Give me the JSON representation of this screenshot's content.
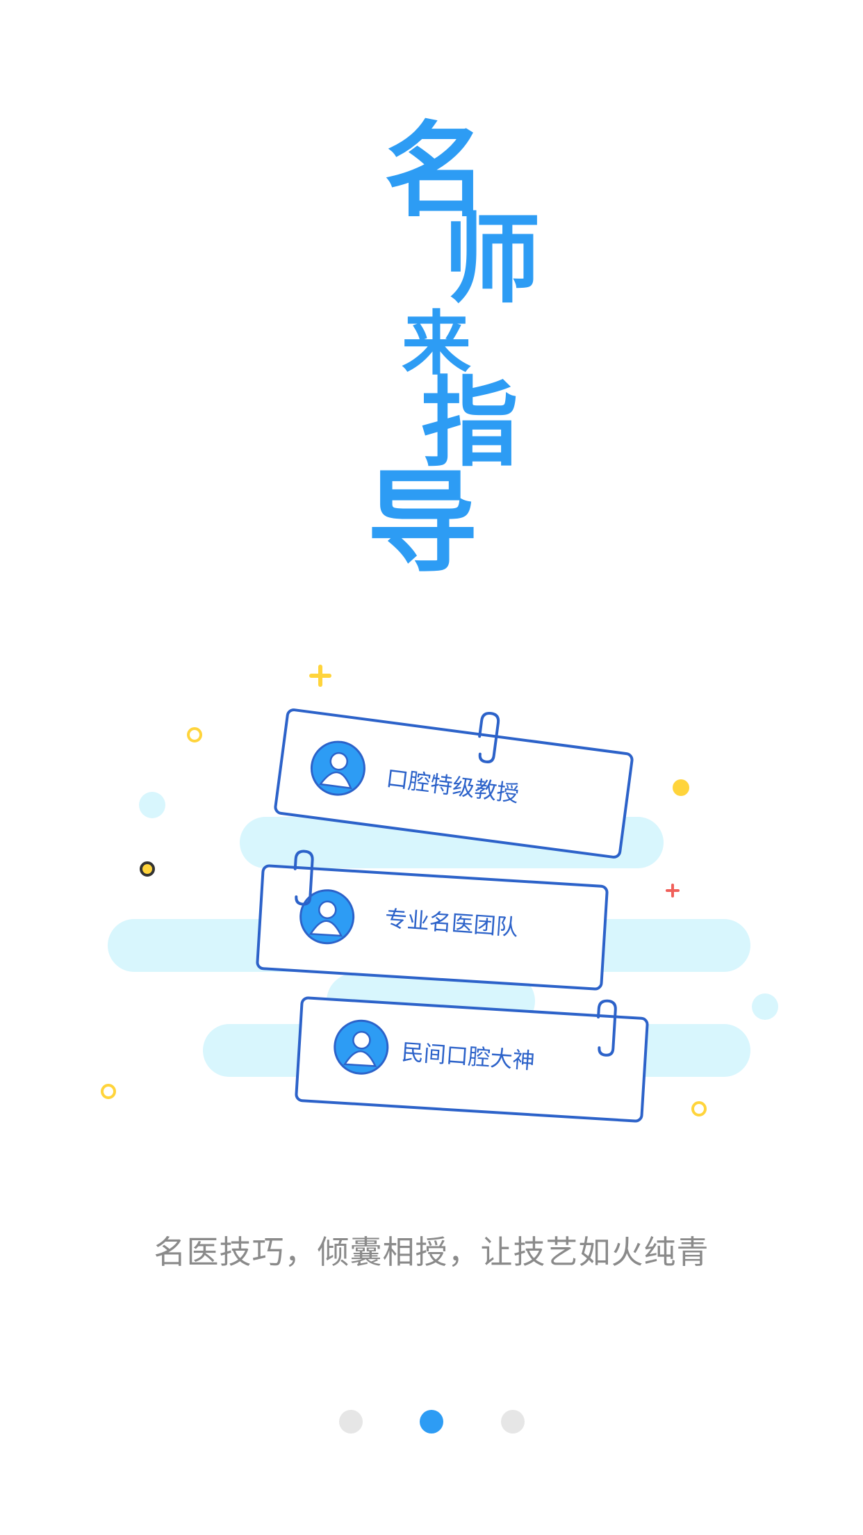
{
  "headline": {
    "chars": [
      "名",
      "师",
      "来",
      "指",
      "导"
    ]
  },
  "cards": [
    {
      "label": "口腔特级教授",
      "icon": "user-avatar-icon"
    },
    {
      "label": "专业名医团队",
      "icon": "user-avatar-icon"
    },
    {
      "label": "民间口腔大神",
      "icon": "user-avatar-icon"
    }
  ],
  "tagline": "名医技巧，倾囊相授，让技艺如火纯青",
  "pager": {
    "count": 3,
    "active_index": 1
  },
  "colors": {
    "accent": "#2d9cf4",
    "card_border": "#2c62c9",
    "cloud": "#d8f6fd",
    "sparkle_yellow": "#ffd43b",
    "sparkle_red": "#f0605a",
    "dot_inactive": "#e6e6e6",
    "tagline": "#8a8a8a"
  }
}
